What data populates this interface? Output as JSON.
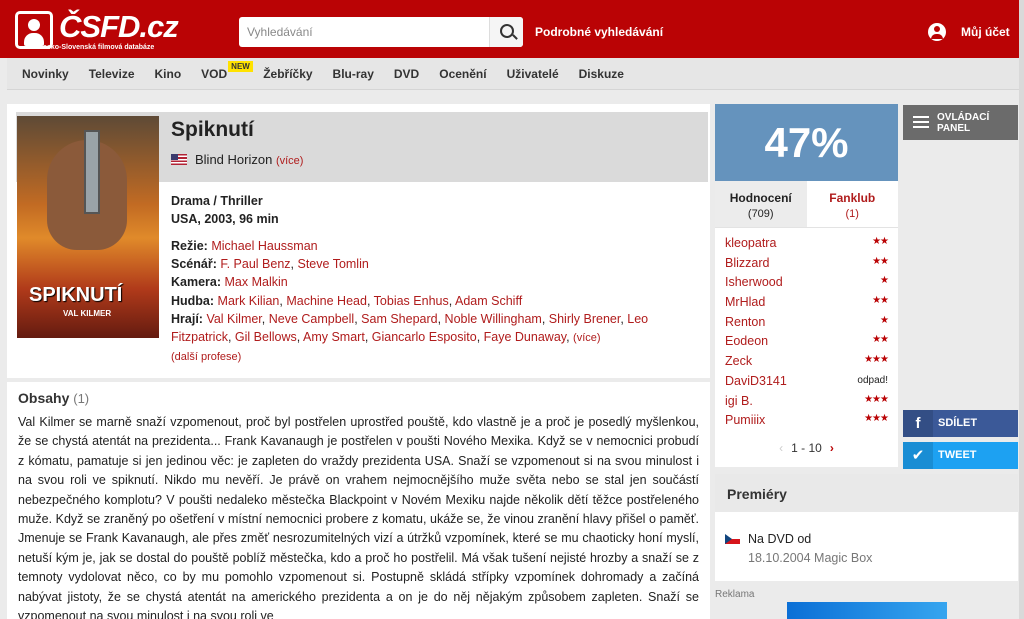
{
  "header": {
    "logo_text": "ČSFD.cz",
    "logo_sub": "Česko-Slovenská filmová databáze",
    "search_placeholder": "Vyhledávání",
    "advanced_search": "Podrobné vyhledávání",
    "account": "Můj účet"
  },
  "nav": {
    "items": [
      "Novinky",
      "Televize",
      "Kino",
      "VOD",
      "Žebříčky",
      "Blu-ray",
      "DVD",
      "Ocenění",
      "Uživatelé",
      "Diskuze"
    ],
    "vod_badge": "NEW"
  },
  "film": {
    "poster_title": "SPIKNUTÍ",
    "poster_sub": "VAL KILMER",
    "title": "Spiknutí",
    "original_title": "Blind Horizon",
    "more": "(více)",
    "genre": "Drama / Thriller",
    "origin": "USA, 2003, 96 min",
    "creators": {
      "directing_label": "Režie:",
      "directing": [
        "Michael Haussman"
      ],
      "writing_label": "Scénář:",
      "writing": [
        "F. Paul Benz",
        "Steve Tomlin"
      ],
      "camera_label": "Kamera:",
      "camera": [
        "Max Malkin"
      ],
      "music_label": "Hudba:",
      "music": [
        "Mark Kilian",
        "Machine Head",
        "Tobias Enhus",
        "Adam Schiff"
      ],
      "cast_label": "Hrají:",
      "cast": [
        "Val Kilmer",
        "Neve Campbell",
        "Sam Shepard",
        "Noble Willingham",
        "Shirly Brener",
        "Leo Fitzpatrick",
        "Gil Bellows",
        "Amy Smart",
        "Giancarlo Esposito",
        "Faye Dunaway"
      ],
      "cast_more": "(více)",
      "more_profession": "(další profese)"
    }
  },
  "plot": {
    "heading": "Obsahy",
    "count": "(1)",
    "text": "Val Kilmer se marně snaží vzpomenout, proč byl postřelen uprostřed pouště, kdo vlastně je a proč je posedlý myšlenkou, že se chystá atentát na prezidenta... Frank Kavanaugh je postřelen v poušti Nového Mexika. Když se v nemocnici probudí z kómatu, pamatuje si jen jedinou věc: je zapleten do vraždy prezidenta USA. Snaží se vzpomenout si na svou minulost i na svou roli ve spiknutí. Nikdo mu nevěří. Je právě on vrahem nejmocnějšího muže světa nebo se stal jen součástí nebezpečného komplotu? V poušti nedaleko městečka Blackpoint v Novém Mexiku najde několik dětí těžce postřeleného muže. Když se zraněný po ošetření v místní nemocnici probere z komatu, ukáže se, že vinou zranění hlavy přišel o paměť. Jmenuje se Frank Kavanaugh, ale přes změť nesrozumitelných vizí a útržků vzpomínek, které se mu chaoticky honí myslí, netuší kým je, jak se dostal do pouště poblíž městečka, kdo a proč ho postřelil. Má však tušení nejisté hrozby a snaží se z temnoty vydolovat něco, co by mu pomohlo vzpomenout si. Postupně skládá střípky vzpomínek dohromady a začíná nabývat jistoty, že se chystá atentát na amerického prezidenta a on je do něj nějakým způsobem zapleten. Snaží se vzpomenout na svou minulost i na svou roli ve"
  },
  "rating": {
    "percent": "47%",
    "box_color": "#6593bd",
    "tab_ratings": "Hodnocení",
    "tab_ratings_count": "(709)",
    "tab_fanclub": "Fanklub",
    "tab_fanclub_count": "(1)",
    "users": [
      {
        "name": "kleopatra",
        "stars": "★★"
      },
      {
        "name": "Blizzard",
        "stars": "★★"
      },
      {
        "name": "Isherwood",
        "stars": "★"
      },
      {
        "name": "MrHlad",
        "stars": "★★"
      },
      {
        "name": "Renton",
        "stars": "★"
      },
      {
        "name": "Eodeon",
        "stars": "★★"
      },
      {
        "name": "Zeck",
        "stars": "★★★"
      },
      {
        "name": "DaviD3141",
        "text": "odpad!"
      },
      {
        "name": "igi B.",
        "stars": "★★★"
      },
      {
        "name": "Pumiiix",
        "stars": "★★★"
      }
    ],
    "pager": "1 - 10"
  },
  "side": {
    "control_panel": "OVLÁDACÍ PANEL",
    "share": "SDÍLET",
    "tweet": "TWEET"
  },
  "premiere": {
    "heading": "Premiéry",
    "item": "Na DVD od",
    "date": "18.10.2004 Magic Box",
    "ad_label": "Reklama"
  }
}
